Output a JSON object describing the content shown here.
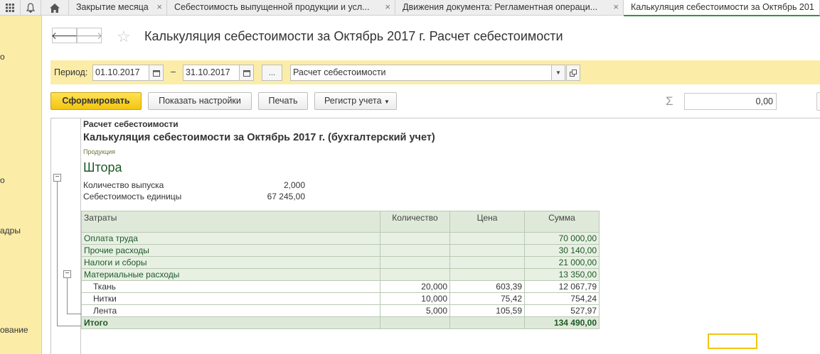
{
  "tabs": [
    {
      "label": "Закрытие месяца"
    },
    {
      "label": "Себестоимость выпущенной продукции и усл..."
    },
    {
      "label": "Движения документа: Регламентная операци..."
    },
    {
      "label": "Калькуляция себестоимости за Октябрь 201"
    }
  ],
  "left_panel": {
    "fragments": [
      "о",
      "о",
      "адры",
      "ование"
    ]
  },
  "header": {
    "title": "Калькуляция себестоимости за Октябрь 2017 г. Расчет себестоимости"
  },
  "params": {
    "period_label": "Период:",
    "date_from": "01.10.2017",
    "dash": "–",
    "date_to": "31.10.2017",
    "ellipsis": "...",
    "report_variant": "Расчет себестоимости"
  },
  "toolbar": {
    "generate": "Сформировать",
    "show_settings": "Показать настройки",
    "print": "Печать",
    "register": "Регистр учета",
    "sum_value": "0,00"
  },
  "report": {
    "caption": "Расчет себестоимости",
    "title": "Калькуляция себестоимости за Октябрь 2017 г. (бухгалтерский учет)",
    "product_label": "Продукция",
    "product_name": "Штора",
    "qty_label": "Количество выпуска",
    "qty_value": "2,000",
    "unit_cost_label": "Себестоимость единицы",
    "unit_cost_value": "67 245,00",
    "table": {
      "headers": [
        "Затраты",
        "Количество",
        "Цена",
        "Сумма"
      ],
      "rows": [
        {
          "name": "Оплата труда",
          "qty": "",
          "price": "",
          "sum": "70 000,00"
        },
        {
          "name": "Прочие расходы",
          "qty": "",
          "price": "",
          "sum": "30 140,00"
        },
        {
          "name": "Налоги и сборы",
          "qty": "",
          "price": "",
          "sum": "21 000,00"
        },
        {
          "name": "Материальные расходы",
          "qty": "",
          "price": "",
          "sum": "13 350,00"
        },
        {
          "name": "Ткань",
          "qty": "20,000",
          "price": "603,39",
          "sum": "12 067,79"
        },
        {
          "name": "Нитки",
          "qty": "10,000",
          "price": "75,42",
          "sum": "754,24"
        },
        {
          "name": "Лента",
          "qty": "5,000",
          "price": "105,59",
          "sum": "527,97"
        }
      ],
      "total": {
        "name": "Итого",
        "sum": "134 490,00"
      }
    }
  },
  "colors": {
    "accent_yellow": "#fbeda8",
    "button_yellow": "#f2c510",
    "green_text": "#1c5a26",
    "tab_active_underline": "#3b8f43"
  }
}
